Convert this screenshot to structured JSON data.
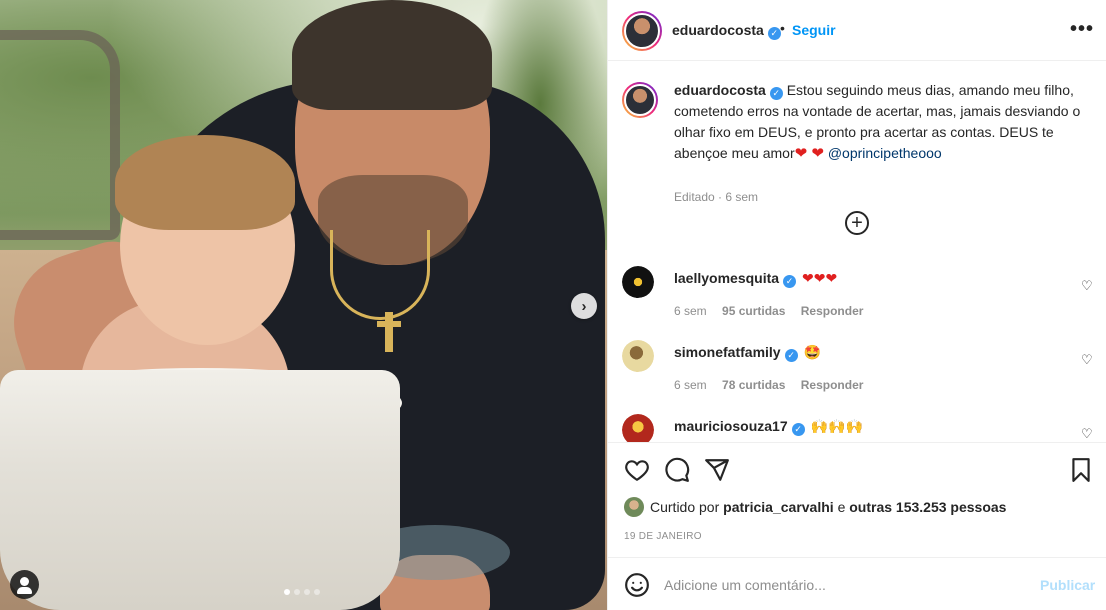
{
  "post": {
    "username": "eduardocosta",
    "bullet": "•",
    "follow_label": "Seguir",
    "more_label": "•••",
    "verified_mark": "✓",
    "nav_next": "›",
    "caption_text": "Estou seguindo meus dias, amando meu filho, cometendo erros na vontade de acertar, mas, jamais desviando o olhar fixo em DEUS, e pronto pra acertar as contas. DEUS te abençoe meu amor",
    "caption_emoji": "❤ ❤",
    "caption_mention": "@oprincipetheooo",
    "caption_meta": "Editado · 6 sem",
    "load_more": "+",
    "carousel_dots": 4,
    "carousel_active": 1
  },
  "comments": [
    {
      "user": "laellyomesquita",
      "emoji": "❤❤❤",
      "age": "6 sem",
      "likes": "95 curtidas",
      "reply": "Responder",
      "like_icon": "♡"
    },
    {
      "user": "simonefatfamily",
      "emoji": "🤩",
      "age": "6 sem",
      "likes": "78 curtidas",
      "reply": "Responder",
      "like_icon": "♡"
    },
    {
      "user": "mauriciosouza17",
      "emoji": "🙌🙌🙌",
      "age": "",
      "likes": "",
      "reply": "",
      "like_icon": "♡"
    }
  ],
  "actions": {
    "liked_by_prefix": "Curtido por",
    "liked_by_user": "patricia_carvalhi",
    "liked_by_and": "e",
    "liked_by_others": "outras 153.253 pessoas",
    "date": "19 DE JANEIRO"
  },
  "add_comment": {
    "placeholder": "Adicione um comentário...",
    "publish_label": "Publicar"
  },
  "colors": {
    "accent": "#0095f6",
    "verified": "#3897f0",
    "publish_disabled": "#b2dffc",
    "muted": "#8e8e8e"
  },
  "icons": [
    "heart-icon",
    "comment-icon",
    "share-icon",
    "bookmark-icon",
    "smile-icon",
    "user-tag-icon",
    "chevron-right-icon",
    "plus-circle-icon",
    "more-icon",
    "verified-icon"
  ]
}
